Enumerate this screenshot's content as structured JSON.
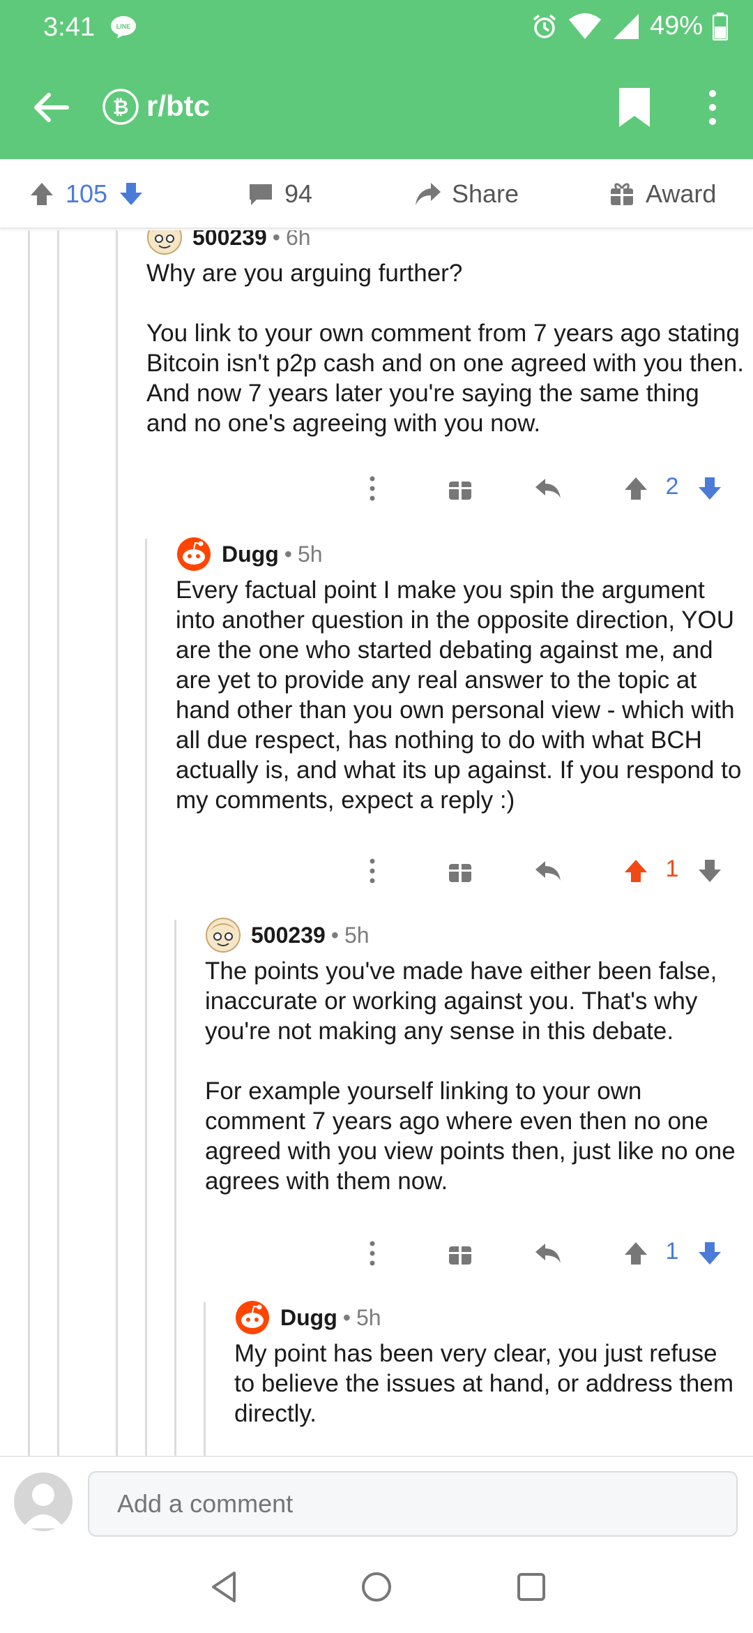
{
  "status_bar": {
    "time": "3:41",
    "battery": "49%",
    "line_badge": "LINE"
  },
  "app_bar": {
    "subreddit": "r/btc"
  },
  "post_actions": {
    "upvotes": "105",
    "comments": "94",
    "share_label": "Share",
    "award_label": "Award"
  },
  "comments": [
    {
      "author": "500239",
      "time": "6h",
      "paragraphs": [
        "Why are you arguing further?",
        "You link to your own comment from 7 years ago stating Bitcoin isn't p2p cash and on one agreed with you then. And now 7 years later you're saying the same thing and no one's agreeing with you now."
      ],
      "score": "2",
      "vote": "none"
    },
    {
      "author": "Dugg",
      "time": "5h",
      "paragraphs": [
        "Every factual point I make you spin the argument into another question in the opposite direction, YOU are the one who started debating against me, and are yet to provide any real answer to the topic at hand other than you own personal view - which with all due respect, has nothing to do with what BCH actually is, and what its up against. If you respond to my comments, expect a reply :)"
      ],
      "score": "1",
      "vote": "up"
    },
    {
      "author": "500239",
      "time": "5h",
      "paragraphs": [
        "The points you've made have either been false, inaccurate or working against you. That's why you're not making any sense in this debate.",
        "For example yourself linking to your own comment 7 years ago where even then no one agreed with you view points then, just like no one agrees with them now."
      ],
      "score": "1",
      "vote": "none"
    },
    {
      "author": "Dugg",
      "time": "5h",
      "paragraphs": [
        "My point has been very clear, you just refuse to believe the issues at hand, or address them directly."
      ]
    }
  ],
  "comment_bar": {
    "placeholder": "Add a comment"
  },
  "colors": {
    "brand_green": "#5ec97a",
    "upvote_orange": "#f04a14",
    "vote_blue": "#4a7bd9"
  },
  "icons": [
    "back-arrow-icon",
    "bitcoin-icon",
    "bookmark-icon",
    "more-vert-icon",
    "upvote-icon",
    "downvote-icon",
    "comment-icon",
    "share-icon",
    "award-icon",
    "reply-icon",
    "alarm-icon",
    "wifi-icon",
    "signal-icon",
    "battery-icon"
  ]
}
